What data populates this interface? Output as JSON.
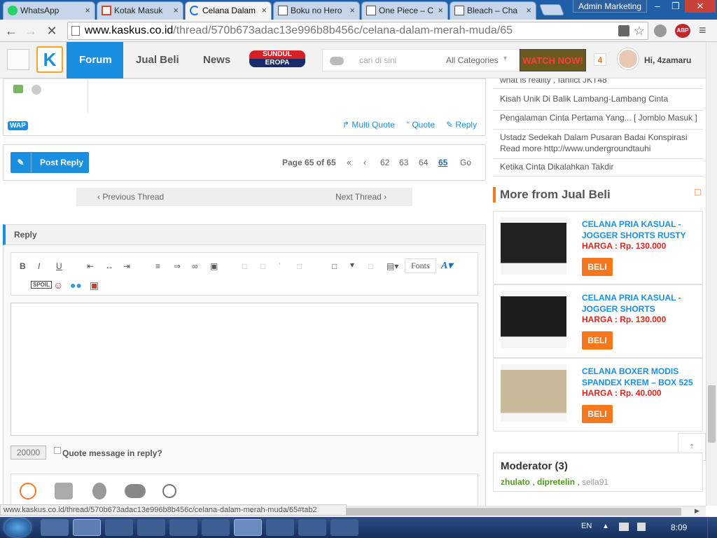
{
  "tabs": [
    {
      "label": "WhatsApp",
      "icon": "whatsapp-icon",
      "close": "×"
    },
    {
      "label": "Kotak Masuk",
      "icon": "gmail-icon",
      "close": "×"
    },
    {
      "label": "Celana Dalam",
      "icon": "loading-icon",
      "close": "×"
    },
    {
      "label": "Boku no Hero",
      "icon": "document-icon",
      "close": "×"
    },
    {
      "label": "One Piece – C",
      "icon": "document-icon",
      "close": "×"
    },
    {
      "label": "Bleach – Cha",
      "icon": "document-icon",
      "close": "×"
    }
  ],
  "window": {
    "profile": "Admin Marketing",
    "min": "–",
    "max": "❐",
    "close": "✕"
  },
  "address": {
    "domain": "www.kaskus.co.id",
    "path": "/thread/570b673adac13e996b8b456c/celana-dalam-merah-muda/65"
  },
  "header": {
    "logo": "K",
    "nav": [
      "Forum",
      "Jual Beli",
      "News"
    ],
    "sundul_line1": "SUNDUL",
    "sundul_line2": "EROPA",
    "search_placeholder": "cari di sini",
    "category": "All Categories",
    "watch": "WATCH NOW!",
    "notif_count": "4",
    "greeting": "Hi, 4zamaru"
  },
  "post": {
    "wap": "WAP",
    "multi_quote": "Multi Quote",
    "quote": "Quote",
    "reply": "Reply"
  },
  "pagination": {
    "post_reply": "Post Reply",
    "page_info": "Page 65 of 65",
    "pages": [
      "62",
      "63",
      "64",
      "65"
    ],
    "current": "65",
    "go": "Go"
  },
  "thread_nav": {
    "prev": "Previous Thread",
    "next": "Next Thread"
  },
  "reply_box": {
    "title": "Reply",
    "fonts": "Fonts",
    "spoil": "SPOIL",
    "char_count": "20000",
    "quote_label": "Quote message in reply?"
  },
  "sidebar": {
    "links": [
      "what is reality , fanfict JKT48",
      "Kisah Unik Di Balik Lambang-Lambang Cinta",
      "Pengalaman Cinta Pertama Yang... [ Jomblo Masuk ]",
      "Ustadz Sedekah Dalam Pusaran Badai Konspirasi Read more http://www.undergroundtauhi",
      "Ketika Cinta Dikalahkan Takdir"
    ],
    "more_title": "More from Jual Beli",
    "products": [
      {
        "title": "CELANA PRIA KASUAL - JOGGER SHORTS RUSTY",
        "price": "HARGA : Rp. 130.000",
        "buy": "BELI"
      },
      {
        "title": "CELANA PRIA KASUAL - JOGGER SHORTS",
        "price": "HARGA : Rp. 130.000",
        "buy": "BELI"
      },
      {
        "title": "CELANA BOXER MODIS SPANDEX KREM – BOX 525",
        "price": "HARGA : Rp. 40.000",
        "buy": "BELI"
      }
    ],
    "moderator_title": "Moderator (3)",
    "moderators": [
      "zhulato",
      "dipretelin",
      "sella91"
    ]
  },
  "statusbar": "www.kaskus.co.id/thread/570b673adac13e996b8b456c/celana-dalam-merah-muda/65#tab2",
  "taskbar": {
    "lang": "EN",
    "time": "8:09"
  },
  "colors": {
    "kaskus_blue": "#1a8fe0",
    "buy_orange": "#f4781f",
    "price_red": "#e0241b",
    "mod_green": "#4a9a1c"
  }
}
